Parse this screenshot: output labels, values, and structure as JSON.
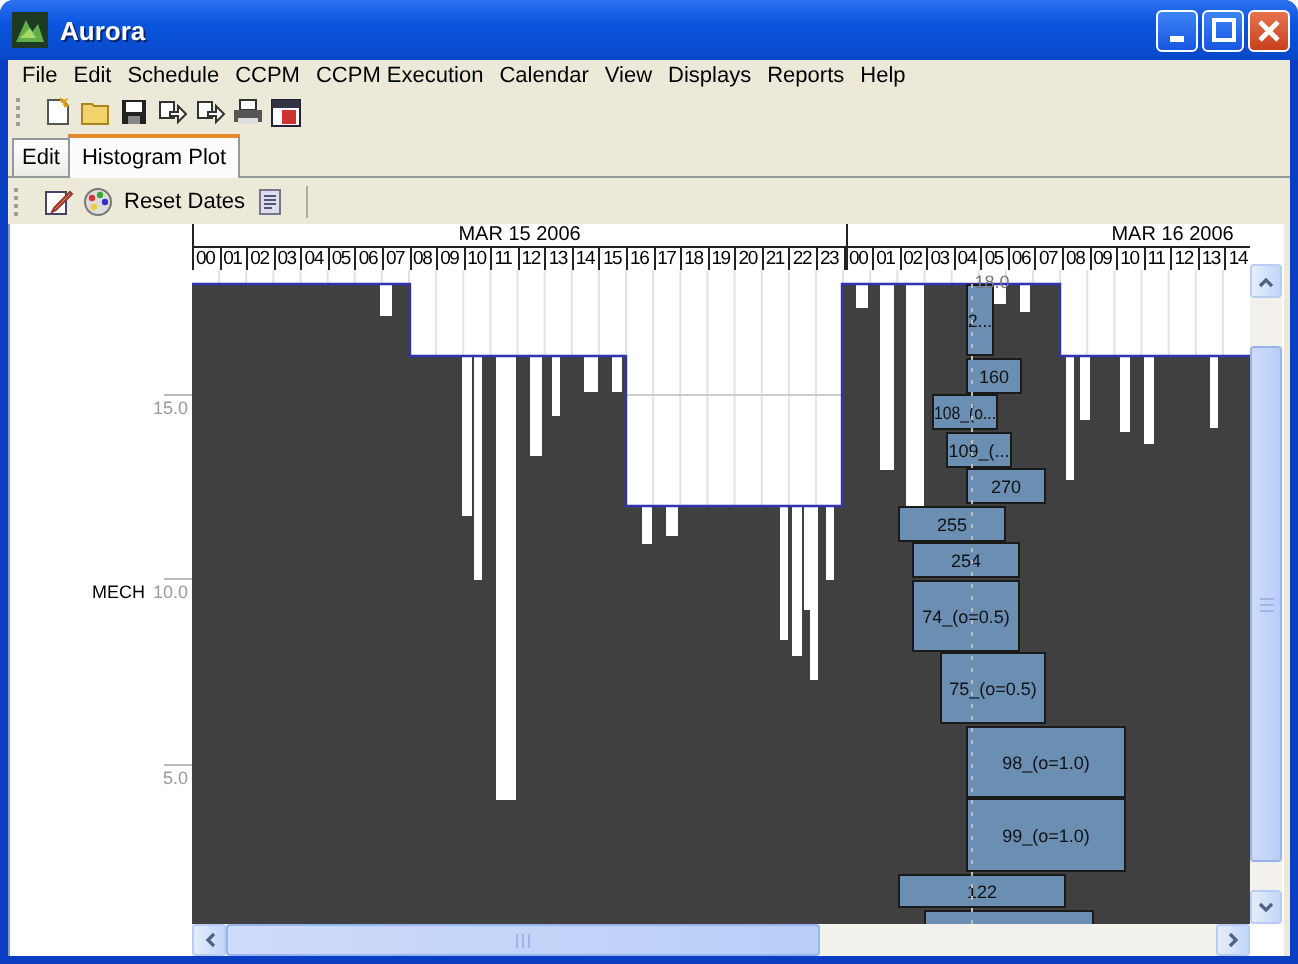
{
  "window": {
    "title": "Aurora"
  },
  "menu": [
    "File",
    "Edit",
    "Schedule",
    "CCPM",
    "CCPM Execution",
    "Calendar",
    "View",
    "Displays",
    "Reports",
    "Help"
  ],
  "tabs": [
    {
      "label": "Edit",
      "selected": false
    },
    {
      "label": "Histogram Plot",
      "selected": true
    }
  ],
  "plot_toolbar": {
    "reset_button": "Reset Dates"
  },
  "plot": {
    "resource": "MECH",
    "y_ticks": [
      "15.0",
      "10.0",
      "5.0"
    ],
    "top_value": "18.0",
    "dates": [
      {
        "label": "MAR 15 2006",
        "hours": [
          "00",
          "01",
          "02",
          "03",
          "04",
          "05",
          "06",
          "07",
          "08",
          "09",
          "10",
          "11",
          "12",
          "13",
          "14",
          "15",
          "16",
          "17",
          "18",
          "19",
          "20",
          "21",
          "22",
          "23"
        ]
      },
      {
        "label": "MAR 16 2006",
        "hours": [
          "00",
          "01",
          "02",
          "03",
          "04",
          "05",
          "06",
          "07",
          "08",
          "09",
          "10",
          "11",
          "12",
          "13",
          "14"
        ]
      }
    ],
    "tasks": [
      {
        "label": "2..."
      },
      {
        "label": "160"
      },
      {
        "label": "108_(o..."
      },
      {
        "label": "109_(..."
      },
      {
        "label": "270"
      },
      {
        "label": "255"
      },
      {
        "label": "254"
      },
      {
        "label": "74_(o=0.5)"
      },
      {
        "label": "75_(o=0.5)"
      },
      {
        "label": "98_(o=1.0)"
      },
      {
        "label": "99_(o=1.0)"
      },
      {
        "label": "122"
      }
    ],
    "cut_off_task_below": true
  }
}
